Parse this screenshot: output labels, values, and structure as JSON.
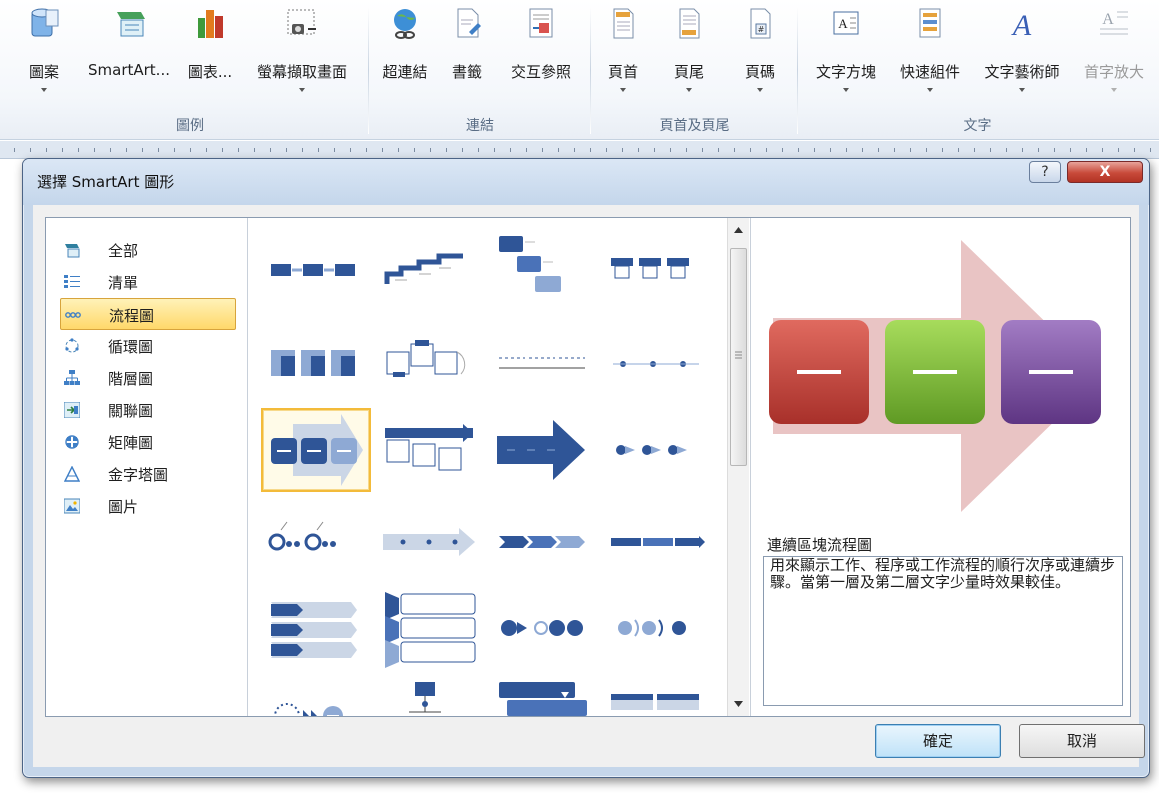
{
  "ribbon": {
    "buttons": [
      {
        "label": "圖案",
        "icon": "shapes-icon",
        "dropdown": true
      },
      {
        "label": "SmartArt...",
        "icon": "smartart-icon",
        "dropdown": false
      },
      {
        "label": "圖表...",
        "icon": "chart-icon",
        "dropdown": false
      },
      {
        "label": "螢幕擷取畫面",
        "icon": "screenshot-icon",
        "dropdown": true
      },
      {
        "label": "超連結",
        "icon": "hyperlink-icon",
        "dropdown": false
      },
      {
        "label": "書籤",
        "icon": "bookmark-icon",
        "dropdown": false
      },
      {
        "label": "交互參照",
        "icon": "cross-reference-icon",
        "dropdown": false
      },
      {
        "label": "頁首",
        "icon": "header-icon",
        "dropdown": true
      },
      {
        "label": "頁尾",
        "icon": "footer-icon",
        "dropdown": true
      },
      {
        "label": "頁碼",
        "icon": "page-number-icon",
        "dropdown": true
      },
      {
        "label": "文字方塊",
        "icon": "text-box-icon",
        "dropdown": true
      },
      {
        "label": "快速組件",
        "icon": "quick-parts-icon",
        "dropdown": true
      },
      {
        "label": "文字藝術師",
        "icon": "wordart-icon",
        "dropdown": true
      },
      {
        "label": "首字放大",
        "icon": "drop-cap-icon",
        "dropdown": true,
        "disabled": true
      }
    ],
    "groups": [
      "圖例",
      "連結",
      "頁首及頁尾",
      "文字"
    ]
  },
  "dialog": {
    "title": "選擇 SmartArt 圖形",
    "help_label": "?",
    "close_label": "X",
    "categories": [
      "全部",
      "清單",
      "流程圖",
      "循環圖",
      "階層圖",
      "關聯圖",
      "矩陣圖",
      "金字塔圖",
      "圖片"
    ],
    "selected_category": "流程圖",
    "selected_layout_index": 8,
    "preview": {
      "name": "連續區塊流程圖",
      "description": "用來顯示工作、程序或工作流程的順行次序或連續步驟。當第一層及第二層文字少量時效果較佳。",
      "block_colors": [
        "#c0392b",
        "#7cb82f",
        "#7d4ea0"
      ],
      "arrow_color": "#e9c4c4"
    },
    "ok_label": "確定",
    "cancel_label": "取消"
  },
  "colors": {
    "accent_blue": "#2f5597",
    "light_blue": "#8ea9d4",
    "selection": "#ffd86a"
  }
}
